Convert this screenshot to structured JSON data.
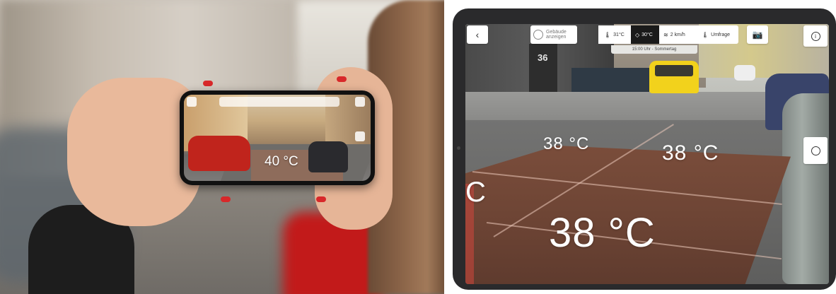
{
  "left_photo": {
    "phone_screen": {
      "temperature_label": "40 °C"
    }
  },
  "tablet": {
    "building_number": "36",
    "toolbar": {
      "back_icon": "chevron-left-icon",
      "show_buildings": {
        "icon": "circle-outline-icon",
        "label": "Gebäude\nanzeigen"
      },
      "air_temp": {
        "icon": "thermometer-icon",
        "label": "31°C"
      },
      "surface_temp": {
        "icon": "surface-diamond-icon",
        "label": "30°C"
      },
      "wind": {
        "icon": "wind-icon",
        "label": "2 km/h"
      },
      "survey": {
        "icon": "survey-thermometer-icon",
        "label": "Umfrage"
      },
      "camera_icon": "camera-icon",
      "info_icon": "info-icon",
      "time_caption": "15:00 Uhr - Sommertag"
    },
    "clock_icon": "clock-icon",
    "temperature_labels": {
      "near_left": "38 °C",
      "near_right": "38 °C",
      "partial_left": "C",
      "big_center": "38 °C"
    }
  }
}
